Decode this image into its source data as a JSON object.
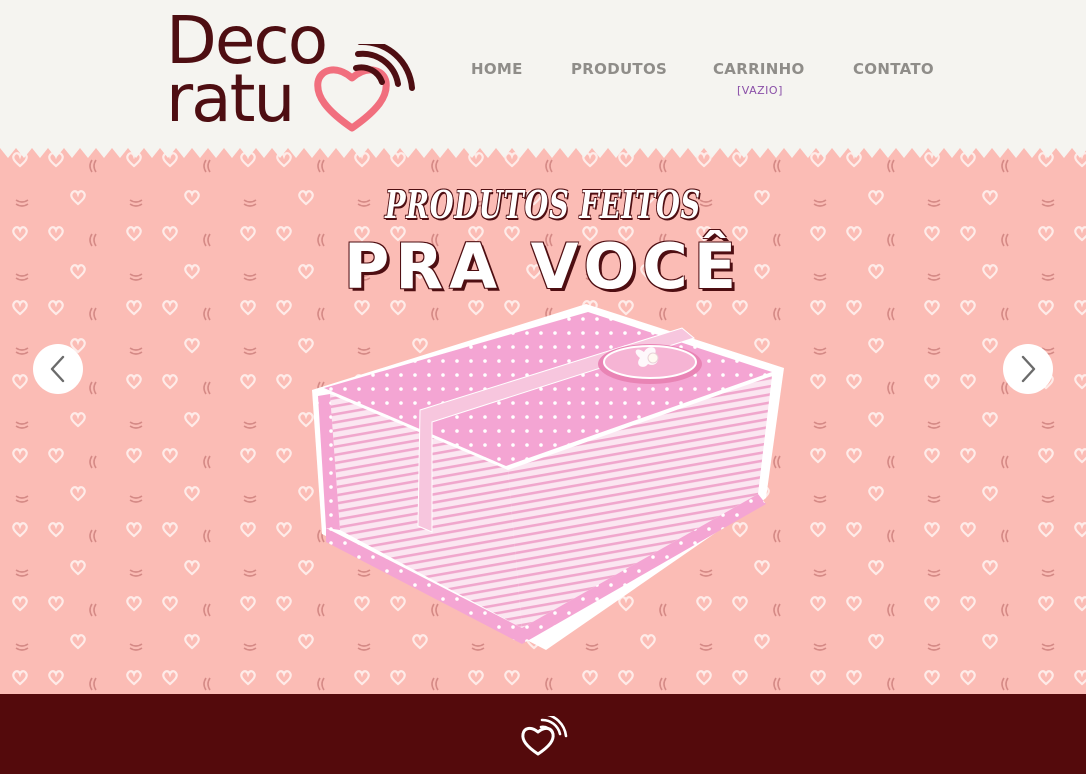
{
  "logo": {
    "line1": "Deco",
    "line2": "ratu"
  },
  "nav": {
    "home": "HOME",
    "produtos": "PRODUTOS",
    "carrinho": "CARRINHO",
    "cart_status": "[VAZIO]",
    "contato": "CONTATO"
  },
  "hero": {
    "subtitle": "PRODUTOS FEITOS",
    "title": "PRA VOCÊ",
    "prev_icon": "chevron-left-icon",
    "next_icon": "chevron-right-icon"
  },
  "colors": {
    "brand_dark": "#4e0e12",
    "brand_pink": "#f16f7e",
    "hero_bg": "#fbbcb5",
    "footer_bg": "#540a0c",
    "nav_text": "#8f8d89",
    "cart_status": "#8a4fa8"
  },
  "footer": {
    "icon": "heart-signal-icon"
  }
}
